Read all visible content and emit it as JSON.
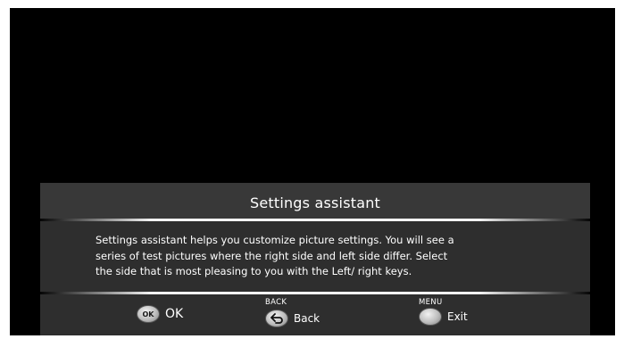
{
  "dialog": {
    "title": "Settings assistant",
    "body_lines": [
      "Settings assistant helps you customize picture settings. You will see a",
      "series of test pictures where the right side and left side differ. Select",
      "the side that is most pleasing to you with the Left/ right keys."
    ]
  },
  "footer": {
    "ok": {
      "button_text": "OK",
      "label": "OK",
      "icon": "ok-button-icon"
    },
    "back": {
      "caption": "BACK",
      "label": "Back",
      "icon": "back-arrow-icon"
    },
    "exit": {
      "caption": "MENU",
      "label": "Exit",
      "icon": "menu-button-icon"
    }
  },
  "colors": {
    "screen_background": "#000000",
    "panel_title": "#383838",
    "panel_body": "#2e2e2e",
    "text": "#ffffff"
  }
}
